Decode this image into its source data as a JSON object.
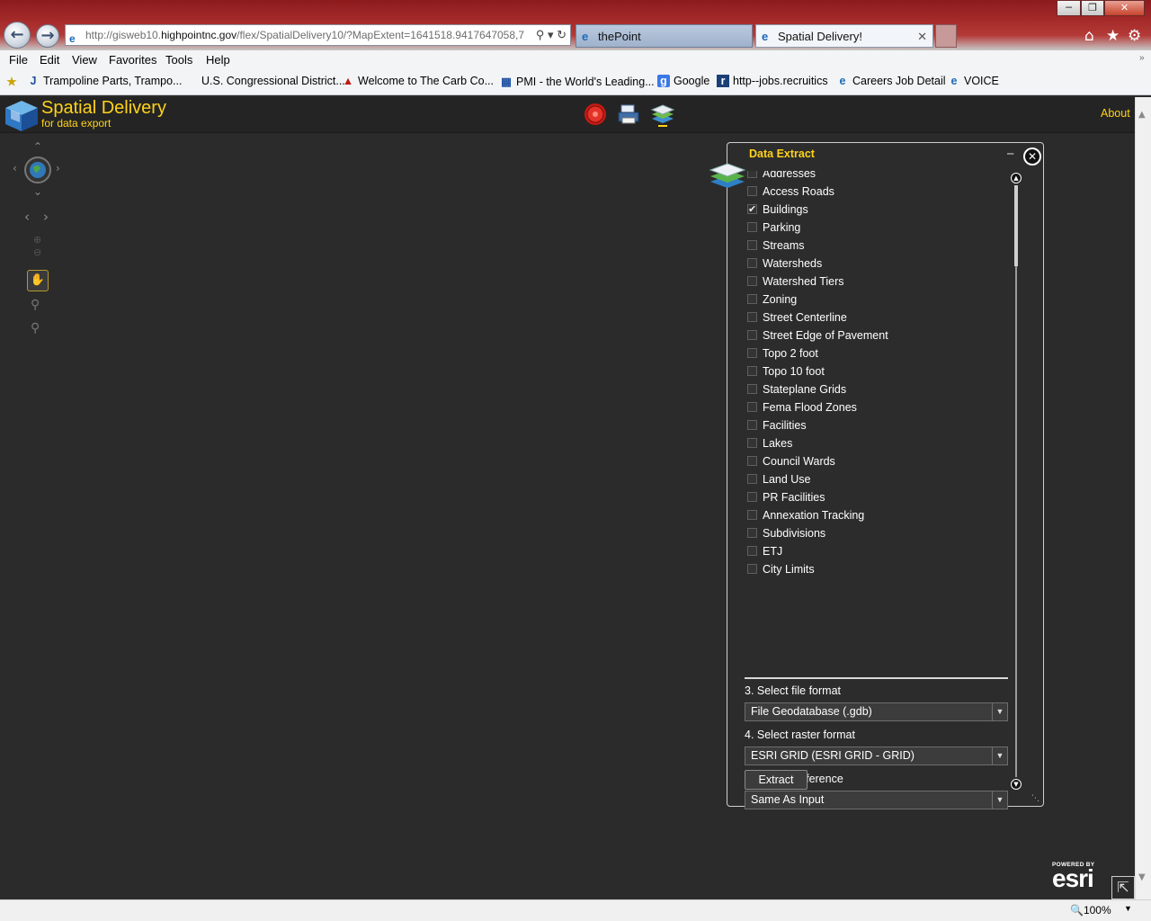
{
  "browser": {
    "address": {
      "prefix": "http://gisweb10.",
      "host": "highpointnc.gov",
      "path": "/flex/SpatialDelivery10/?MapExtent=1641518.9417647058,7"
    },
    "tabs": [
      {
        "label": "thePoint"
      },
      {
        "label": "Spatial Delivery!"
      }
    ],
    "menu": [
      "File",
      "Edit",
      "View",
      "Favorites",
      "Tools",
      "Help"
    ],
    "favorites": [
      "Trampoline Parts, Trampo...",
      "U.S. Congressional District...",
      "Welcome to The Carb Co...",
      "PMI - the World's Leading...",
      "Google",
      "http--jobs.recruitics",
      "Careers  Job Detail",
      "VOICE"
    ],
    "zoom": "100%"
  },
  "app": {
    "title": "Spatial Delivery",
    "subtitle": "for data export",
    "about": "About"
  },
  "panel": {
    "title": "Data Extract",
    "layers": [
      {
        "label": "Addresses",
        "checked": false
      },
      {
        "label": "Access Roads",
        "checked": false
      },
      {
        "label": "Buildings",
        "checked": true
      },
      {
        "label": "Parking",
        "checked": false
      },
      {
        "label": "Streams",
        "checked": false
      },
      {
        "label": "Watersheds",
        "checked": false
      },
      {
        "label": "Watershed Tiers",
        "checked": false
      },
      {
        "label": "Zoning",
        "checked": false
      },
      {
        "label": "Street Centerline",
        "checked": false
      },
      {
        "label": "Street Edge of Pavement",
        "checked": false
      },
      {
        "label": "Topo 2 foot",
        "checked": false
      },
      {
        "label": "Topo 10 foot",
        "checked": false
      },
      {
        "label": "Stateplane Grids",
        "checked": false
      },
      {
        "label": "Fema Flood Zones",
        "checked": false
      },
      {
        "label": "Facilities",
        "checked": false
      },
      {
        "label": "Lakes",
        "checked": false
      },
      {
        "label": "Council Wards",
        "checked": false
      },
      {
        "label": "Land Use",
        "checked": false
      },
      {
        "label": "PR Facilities",
        "checked": false
      },
      {
        "label": "Annexation Tracking",
        "checked": false
      },
      {
        "label": "Subdivisions",
        "checked": false
      },
      {
        "label": "ETJ",
        "checked": false
      },
      {
        "label": "City Limits",
        "checked": false
      }
    ],
    "file_format_label": "3. Select file format",
    "file_format_value": "File Geodatabase (.gdb)",
    "raster_format_label": "4. Select raster format",
    "raster_format_value": "ESRI GRID (ESRI GRID - GRID)",
    "spatial_ref_label": "5. SpatialReference",
    "spatial_ref_value": "Same As Input",
    "extract_label": "Extract"
  },
  "branding": {
    "powered": "POWERED BY",
    "esri": "esri"
  },
  "colors": {
    "accent": "#ffd21a",
    "panel_bg": "#2c2c2c",
    "map_bg": "#2b2b2b"
  }
}
